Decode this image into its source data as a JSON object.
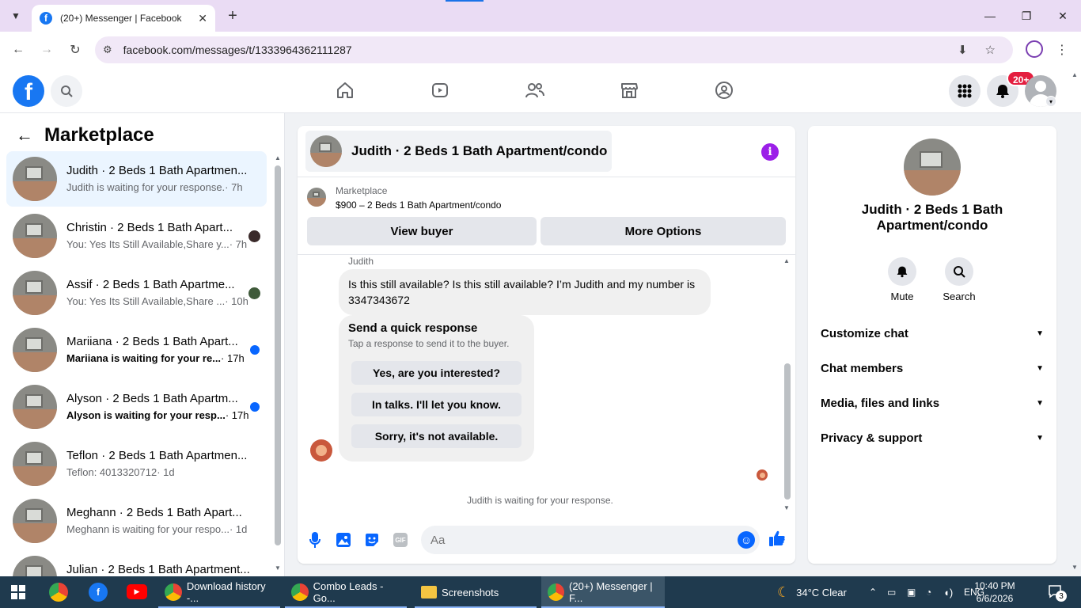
{
  "browser": {
    "tab_title": "(20+) Messenger | Facebook",
    "url": "facebook.com/messages/t/1333964362111287"
  },
  "topbar": {
    "notification_badge": "20+"
  },
  "sidebar": {
    "title": "Marketplace",
    "conversations": [
      {
        "name": "Judith · 2 Beds 1 Bath Apartmen...",
        "preview": "Judith is waiting for your response.",
        "time": "· 7h",
        "active": true,
        "unread": false
      },
      {
        "name": "Christin · 2 Beds 1 Bath Apart...",
        "preview": "You: Yes Its Still Available,Share y...",
        "time": "· 7h",
        "active": false,
        "unread": false
      },
      {
        "name": "Assif · 2 Beds 1 Bath Apartme...",
        "preview": "You: Yes Its Still Available,Share ...",
        "time": "· 10h",
        "active": false,
        "unread": false
      },
      {
        "name": "Mariiana · 2 Beds 1 Bath Apart...",
        "preview": "Mariiana is waiting for your re...",
        "time": "· 17h",
        "active": false,
        "unread": true
      },
      {
        "name": "Alyson · 2 Beds 1 Bath Apartm...",
        "preview": "Alyson is waiting for your resp...",
        "time": "· 17h",
        "active": false,
        "unread": true
      },
      {
        "name": "Teflon · 2 Beds 1 Bath Apartmen...",
        "preview": "Teflon: 4013320712",
        "time": "· 1d",
        "active": false,
        "unread": false
      },
      {
        "name": "Meghann · 2 Beds 1 Bath Apart...",
        "preview": "Meghann is waiting for your respo...",
        "time": "· 1d",
        "active": false,
        "unread": false
      },
      {
        "name": "Julian · 2 Beds 1 Bath Apartment...",
        "preview": "",
        "time": "",
        "active": false,
        "unread": false
      }
    ]
  },
  "chat": {
    "header_title": "Judith · 2 Beds 1 Bath Apartment/condo",
    "marketplace_label": "Marketplace",
    "listing": "$900 – 2 Beds 1 Bath Apartment/condo",
    "view_buyer": "View buyer",
    "more_options": "More Options",
    "sender": "Judith",
    "message": "Is this still available? Is this still available? I’m Judith and my number is 3347343672",
    "quick_title": "Send a quick response",
    "quick_subtitle": "Tap a response to send it to the buyer.",
    "quick_responses": [
      "Yes, are you interested?",
      "In talks. I'll let you know.",
      "Sorry, it's not available."
    ],
    "waiting_note": "Judith is waiting for your response.",
    "input_placeholder": "Aa",
    "gif_label": "GIF"
  },
  "details": {
    "name": "Judith · 2 Beds 1 Bath Apartment/condo",
    "mute": "Mute",
    "search": "Search",
    "sections": [
      "Customize chat",
      "Chat members",
      "Media, files and links",
      "Privacy & support"
    ]
  },
  "taskbar": {
    "apps": [
      "Download history -...",
      "Combo Leads - Go...",
      "Screenshots",
      "(20+) Messenger | F..."
    ],
    "weather": "34°C  Clear",
    "lang": "ENG",
    "time": "10:40 PM",
    "date": "6/6/2026",
    "notifications": "3"
  },
  "colors": {
    "accent": "#0866ff",
    "fb_blue": "#1877f2",
    "badge_red": "#e41e3f",
    "info_purple": "#9b1fe8"
  }
}
